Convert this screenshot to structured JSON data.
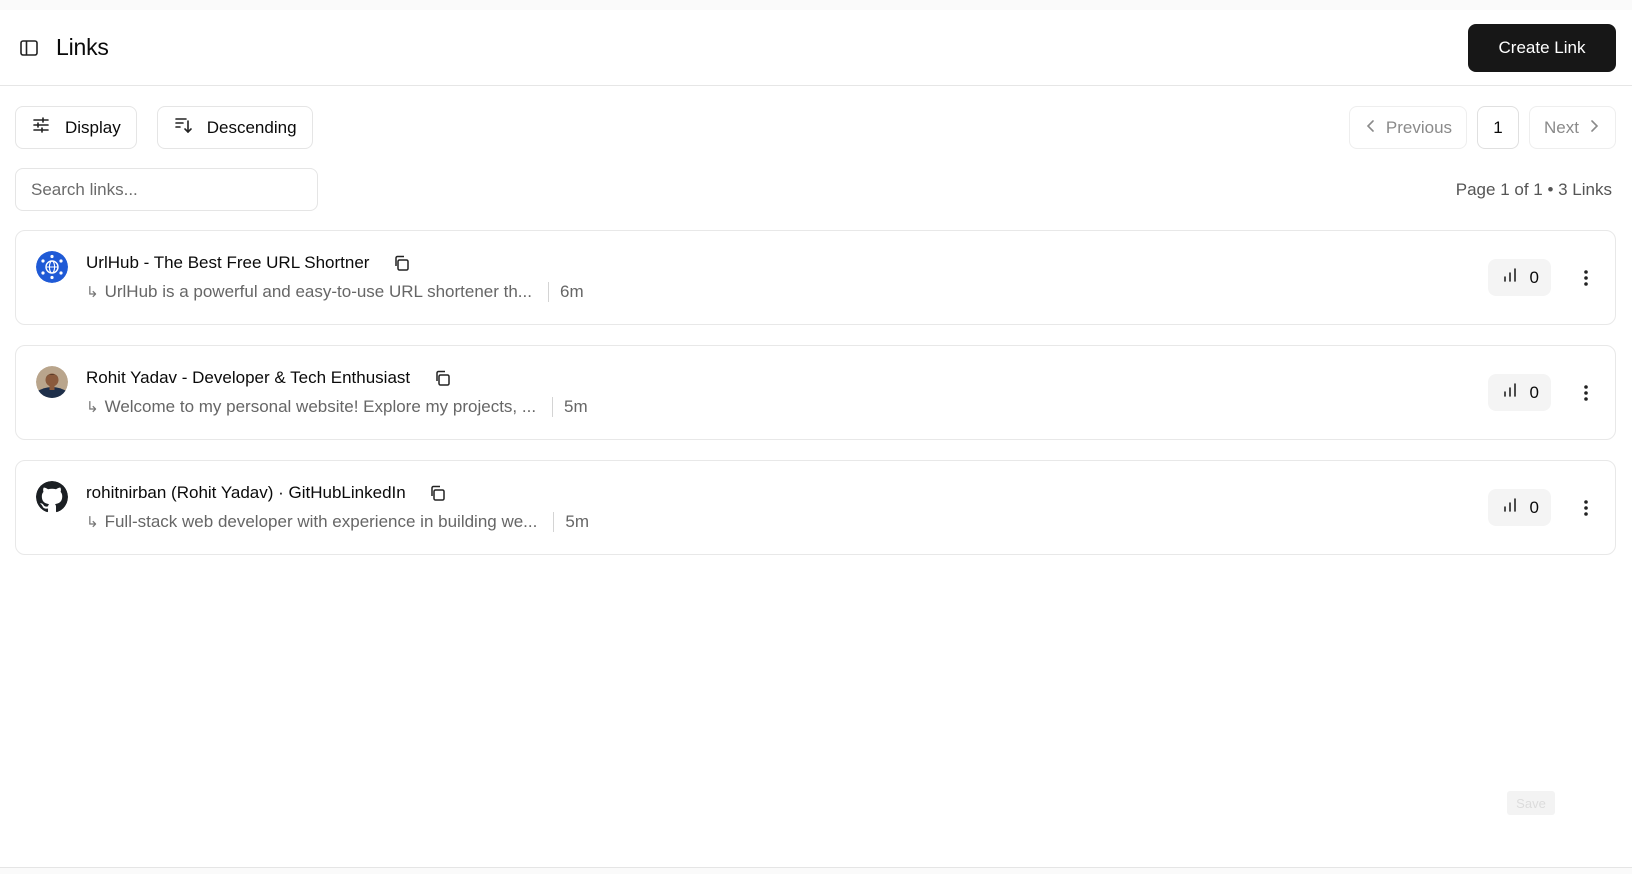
{
  "header": {
    "title": "Links",
    "create_label": "Create Link"
  },
  "toolbar": {
    "display_label": "Display",
    "sort_label": "Descending"
  },
  "pagination": {
    "previous_label": "Previous",
    "current_page": "1",
    "next_label": "Next",
    "summary": "Page 1 of 1 • 3 Links"
  },
  "search": {
    "placeholder": "Search links..."
  },
  "links": [
    {
      "title": "UrlHub - The Best Free URL Shortner",
      "description": "UrlHub is a powerful and easy-to-use URL shortener th...",
      "age": "6m",
      "clicks": "0",
      "icon": "urlhub-globe-icon"
    },
    {
      "title": "Rohit Yadav - Developer & Tech Enthusiast",
      "description": "Welcome to my personal website! Explore my projects, ...",
      "age": "5m",
      "clicks": "0",
      "icon": "avatar-photo"
    },
    {
      "title": "rohitnirban (Rohit Yadav) · GitHubLinkedIn",
      "description": "Full-stack web developer with experience in building we...",
      "age": "5m",
      "clicks": "0",
      "icon": "github-icon"
    }
  ],
  "floating": {
    "save_label": "Save"
  },
  "colors": {
    "primary_button": "#171717",
    "border": "#e5e5e5",
    "badge_bg": "#f4f4f4",
    "urlhub_blue": "#1f5ad6"
  }
}
